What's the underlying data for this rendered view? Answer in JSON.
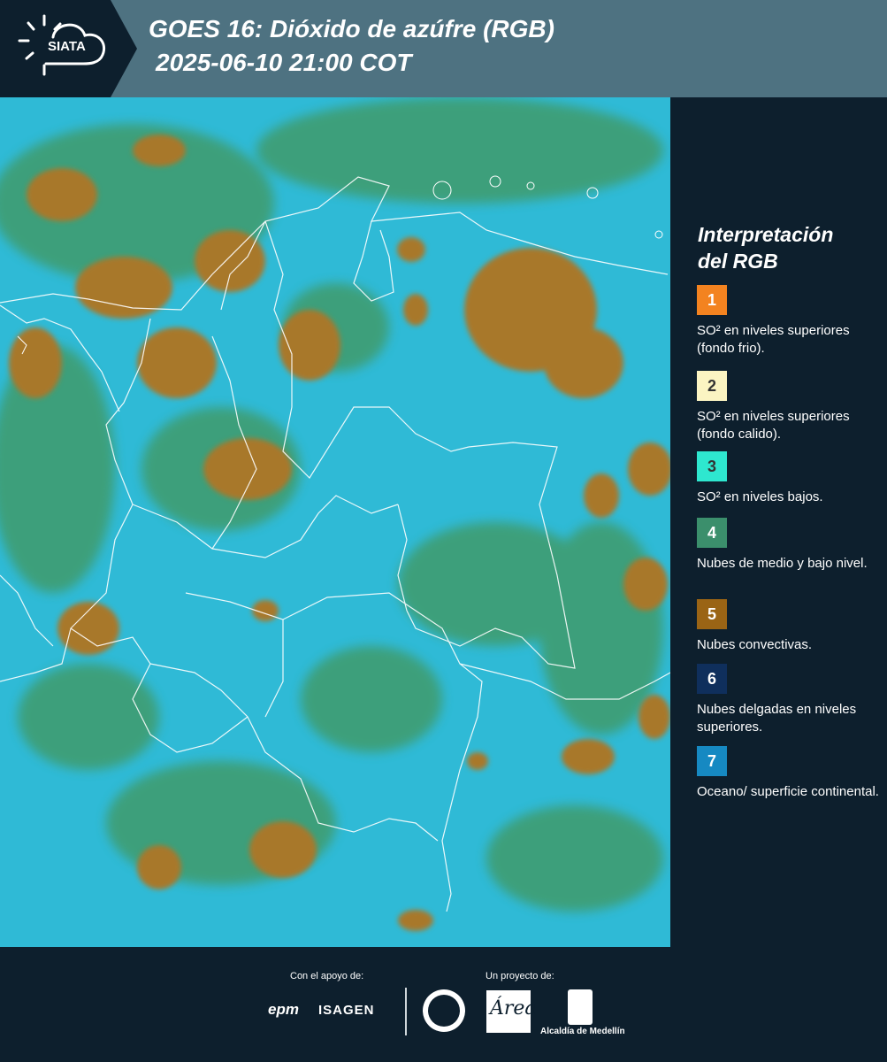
{
  "header": {
    "logo_text": "SIATA",
    "title_line1": "GOES 16: Dióxido de azúfre (RGB)",
    "title_line2": "2025-06-10 21:00 COT"
  },
  "legend": {
    "title_line1": "Interpretación",
    "title_line2": "del RGB",
    "items": [
      {
        "num": "1",
        "color": "#f38320",
        "text": "SO² en niveles superiores (fondo frio)."
      },
      {
        "num": "2",
        "color": "#fbf4c2",
        "text": "SO² en niveles superiores (fondo calido)."
      },
      {
        "num": "3",
        "color": "#2ee7cf",
        "text": "SO² en niveles bajos."
      },
      {
        "num": "4",
        "color": "#3b8f6c",
        "text": "Nubes de medio y bajo nivel."
      },
      {
        "num": "5",
        "color": "#9a6415",
        "text": "Nubes convectivas."
      },
      {
        "num": "6",
        "color": "#0f2f5c",
        "text": "Nubes delgadas en niveles superiores."
      },
      {
        "num": "7",
        "color": "#1689c2",
        "text": "Oceano/ superficie continental."
      }
    ]
  },
  "footer": {
    "support_label": "Con el apoyo de:",
    "project_label": "Un proyecto de:",
    "sponsor_1": "epm",
    "sponsor_2": "ISAGEN",
    "partner_logo_text": "Área",
    "partner_2": "Alcaldía de Medellín"
  }
}
